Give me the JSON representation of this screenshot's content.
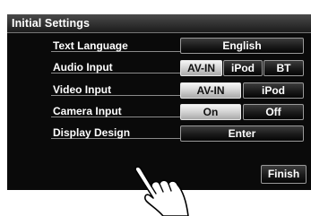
{
  "title": "Initial Settings",
  "rows": [
    {
      "label": "Text Language",
      "buttons": [
        {
          "label": "English",
          "selected": false
        }
      ]
    },
    {
      "label": "Audio Input",
      "buttons": [
        {
          "label": "AV-IN",
          "selected": true
        },
        {
          "label": "iPod",
          "selected": false
        },
        {
          "label": "BT",
          "selected": false
        }
      ]
    },
    {
      "label": "Video Input",
      "buttons": [
        {
          "label": "AV-IN",
          "selected": true
        },
        {
          "label": "iPod",
          "selected": false
        }
      ]
    },
    {
      "label": "Camera Input",
      "buttons": [
        {
          "label": "On",
          "selected": true
        },
        {
          "label": "Off",
          "selected": false
        }
      ]
    },
    {
      "label": "Display Design",
      "buttons": [
        {
          "label": "Enter",
          "selected": false
        }
      ]
    }
  ],
  "finish_label": "Finish",
  "colors": {
    "background": "#0a0a0a",
    "selected": "#d8d8d8",
    "text": "#ffffff"
  },
  "icons": {
    "pointer": "pointing-hand-icon"
  }
}
